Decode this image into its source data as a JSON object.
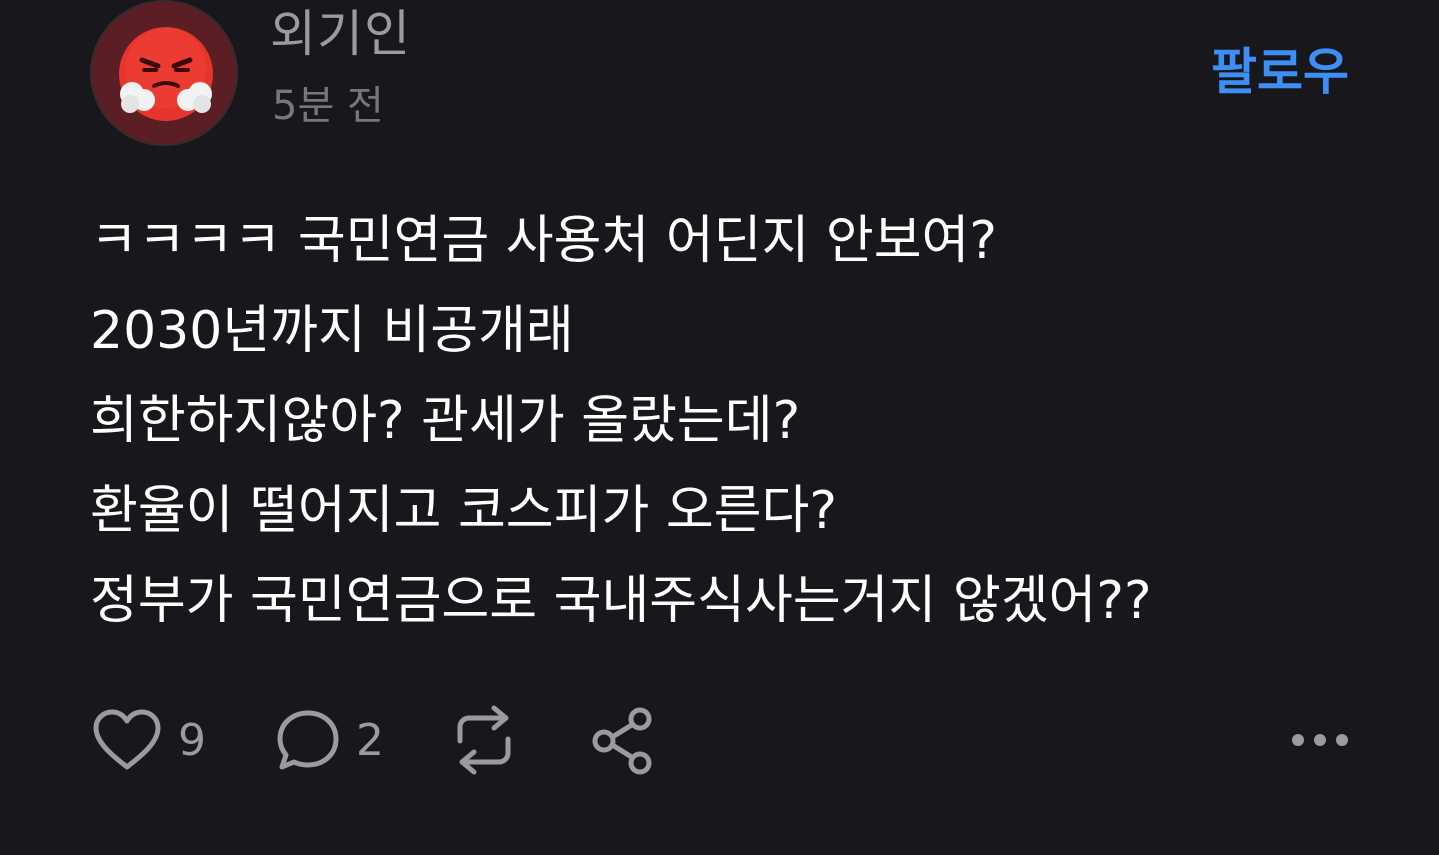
{
  "post": {
    "author": "외기인",
    "time": "5분 전",
    "follow_label": "팔로우",
    "lines": [
      "ㅋㅋㅋㅋ 국민연금 사용처 어딘지 안보여?",
      "2030년까지 비공개래",
      "희한하지않아? 관세가 올랐는데?",
      "환율이 떨어지고 코스피가 오른다?",
      "정부가 국민연금으로 국내주식사는거지 않겠어??"
    ],
    "likes": "9",
    "comments": "2",
    "icons": {
      "avatar": "steaming-angry-face-emoji",
      "like": "heart-icon",
      "comment": "speech-bubble-icon",
      "repost": "repost-icon",
      "share": "share-icon",
      "more": "more-dots-icon"
    },
    "colors": {
      "background": "#18181c",
      "accent": "#3d8ff5",
      "muted": "#9a9aa2"
    }
  }
}
